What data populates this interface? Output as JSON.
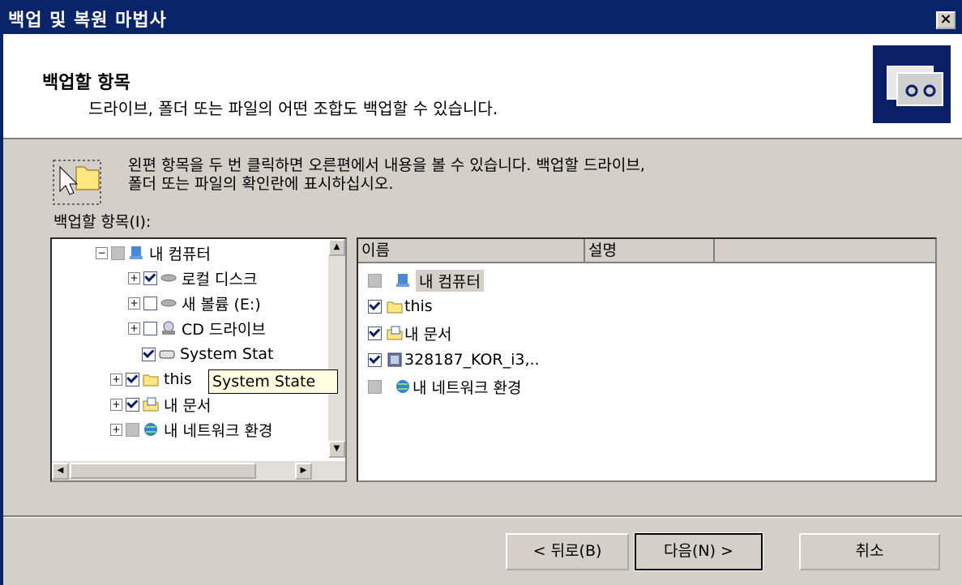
{
  "window": {
    "title": "백업 및 복원 마법사",
    "close_label": "×"
  },
  "header": {
    "title": "백업할 항목",
    "subtitle": "드라이브, 폴더 또는 파일의 어떤 조합도 백업할 수 있습니다.",
    "icon": "backup-tape-icon"
  },
  "instructions": {
    "line1": "왼편 항목을 두 번 클릭하면 오른편에서 내용을 볼 수 있습니다. 백업할 드라이브,",
    "line2": "폴더 또는 파일의 확인란에 표시하십시오."
  },
  "tree": {
    "label": "백업할 항목(I):",
    "items": [
      {
        "label": "내 컴퓨터",
        "expander": "−",
        "check": "gray",
        "icon": "computer-icon"
      },
      {
        "label": "로컬 디스크",
        "expander": "+",
        "check": "checked",
        "icon": "drive-icon"
      },
      {
        "label": "새 볼륨 (E:)",
        "expander": "+",
        "check": "unchecked",
        "icon": "drive-icon"
      },
      {
        "label": "CD 드라이브",
        "expander": "+",
        "check": "unchecked",
        "icon": "cd-drive-icon"
      },
      {
        "label": "System Stat",
        "expander": "",
        "check": "checked",
        "icon": "system-state-icon"
      },
      {
        "label": "this",
        "expander": "+",
        "check": "checked",
        "icon": "folder-icon"
      },
      {
        "label": "내 문서",
        "expander": "+",
        "check": "checked",
        "icon": "documents-icon"
      },
      {
        "label": "내 네트워크 환경",
        "expander": "+",
        "check": "gray",
        "icon": "network-icon"
      }
    ],
    "tooltip": "System State"
  },
  "list": {
    "columns": [
      "이름",
      "설명"
    ],
    "rows": [
      {
        "name": "내 컴퓨터",
        "check": "gray",
        "icon": "computer-icon"
      },
      {
        "name": "this",
        "check": "checked",
        "icon": "folder-icon"
      },
      {
        "name": "내 문서",
        "check": "checked",
        "icon": "documents-icon"
      },
      {
        "name": "328187_KOR_i3,..",
        "check": "checked",
        "icon": "file-icon"
      },
      {
        "name": "내 네트워크 환경",
        "check": "gray",
        "icon": "network-icon"
      }
    ]
  },
  "buttons": {
    "back": "< 뒤로(B)",
    "next": "다음(N) >",
    "cancel": "취소"
  },
  "colors": {
    "titlebar": "#0a246a",
    "dialog": "#d4d0c8",
    "tooltip": "#ffffe1"
  }
}
